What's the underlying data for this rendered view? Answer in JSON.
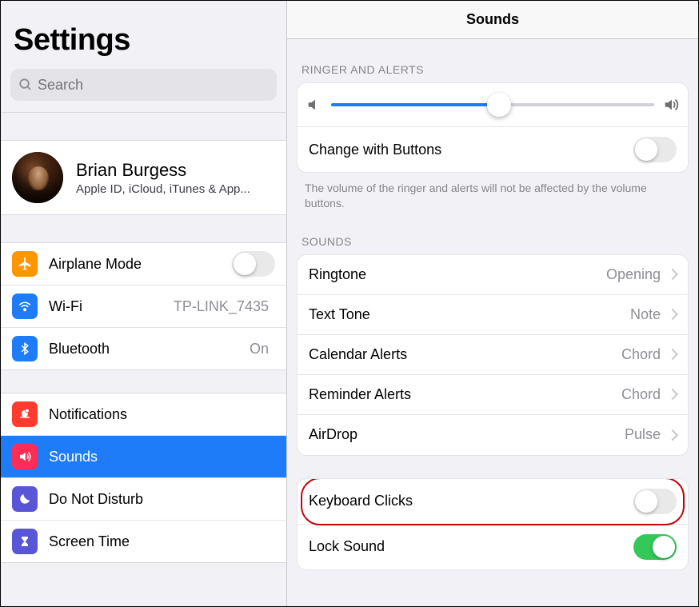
{
  "sidebar": {
    "title": "Settings",
    "search_placeholder": "Search",
    "profile": {
      "name": "Brian Burgess",
      "subtitle": "Apple ID, iCloud, iTunes & App..."
    },
    "items": [
      {
        "label": "Airplane Mode",
        "value": "",
        "icon": "airplane",
        "color": "#ff9500",
        "toggle": false
      },
      {
        "label": "Wi-Fi",
        "value": "TP-LINK_7435",
        "icon": "wifi",
        "color": "#1f7cf9"
      },
      {
        "label": "Bluetooth",
        "value": "On",
        "icon": "bluetooth",
        "color": "#1f7cf9"
      }
    ],
    "items2": [
      {
        "label": "Notifications",
        "icon": "bell",
        "color": "#ff3b30"
      },
      {
        "label": "Sounds",
        "icon": "speaker",
        "color": "#ff2d55",
        "selected": true
      },
      {
        "label": "Do Not Disturb",
        "icon": "moon",
        "color": "#5856d6"
      },
      {
        "label": "Screen Time",
        "icon": "hourglass",
        "color": "#5856d6"
      }
    ]
  },
  "detail": {
    "title": "Sounds",
    "ringer_section": "Ringer and Alerts",
    "slider_value": 52,
    "change_buttons": "Change with Buttons",
    "change_buttons_on": false,
    "footnote": "The volume of the ringer and alerts will not be affected by the volume buttons.",
    "sounds_section": "Sounds",
    "sound_rows": [
      {
        "label": "Ringtone",
        "value": "Opening"
      },
      {
        "label": "Text Tone",
        "value": "Note"
      },
      {
        "label": "Calendar Alerts",
        "value": "Chord"
      },
      {
        "label": "Reminder Alerts",
        "value": "Chord"
      },
      {
        "label": "AirDrop",
        "value": "Pulse"
      }
    ],
    "toggle_rows": [
      {
        "label": "Keyboard Clicks",
        "on": false,
        "highlight": true
      },
      {
        "label": "Lock Sound",
        "on": true
      }
    ]
  }
}
